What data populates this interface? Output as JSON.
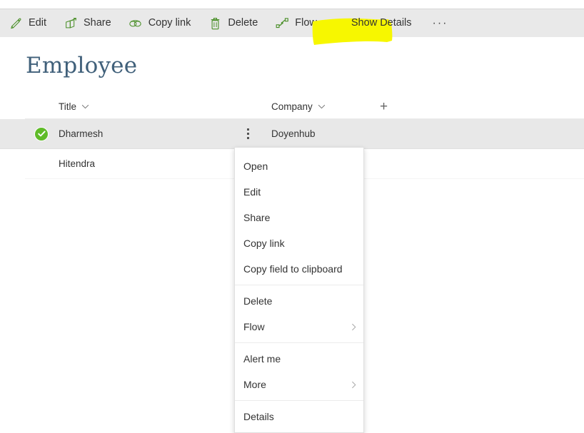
{
  "commandbar": {
    "items": [
      {
        "label": "Edit",
        "icon": "pencil-icon",
        "has_chevron": false
      },
      {
        "label": "Share",
        "icon": "share-icon",
        "has_chevron": false
      },
      {
        "label": "Copy link",
        "icon": "link-icon",
        "has_chevron": false
      },
      {
        "label": "Delete",
        "icon": "trash-icon",
        "has_chevron": false
      },
      {
        "label": "Flow",
        "icon": "flow-icon",
        "has_chevron": true
      }
    ],
    "show_details_label": "Show Details",
    "overflow_label": "···",
    "chevron_glyph": "⌄",
    "accent_color": "#4a8f28",
    "background_color": "#e9e9e9",
    "highlight_color": "#f7f700"
  },
  "page": {
    "title": "Employee",
    "title_color": "#40607a"
  },
  "list": {
    "columns": [
      {
        "label": "Title",
        "chevron": "⌄"
      },
      {
        "label": "Company",
        "chevron": "⌄"
      }
    ],
    "add_column_glyph": "+",
    "rows": [
      {
        "title": "Dharmesh",
        "company": "Doyenhub",
        "selected": true
      },
      {
        "title": "Hitendra",
        "company": "",
        "selected": false
      }
    ],
    "selected_color": "#e8e8e8",
    "check_color": "#5fbb28"
  },
  "context_menu": {
    "groups": [
      {
        "items": [
          {
            "label": "Open",
            "submenu": false
          },
          {
            "label": "Edit",
            "submenu": false
          },
          {
            "label": "Share",
            "submenu": false
          },
          {
            "label": "Copy link",
            "submenu": false
          },
          {
            "label": "Copy field to clipboard",
            "submenu": false
          }
        ]
      },
      {
        "items": [
          {
            "label": "Delete",
            "submenu": false
          },
          {
            "label": "Flow",
            "submenu": true
          }
        ]
      },
      {
        "items": [
          {
            "label": "Alert me",
            "submenu": false
          },
          {
            "label": "More",
            "submenu": true
          }
        ]
      },
      {
        "items": [
          {
            "label": "Details",
            "submenu": false
          }
        ]
      }
    ],
    "submenu_glyph": "›"
  }
}
